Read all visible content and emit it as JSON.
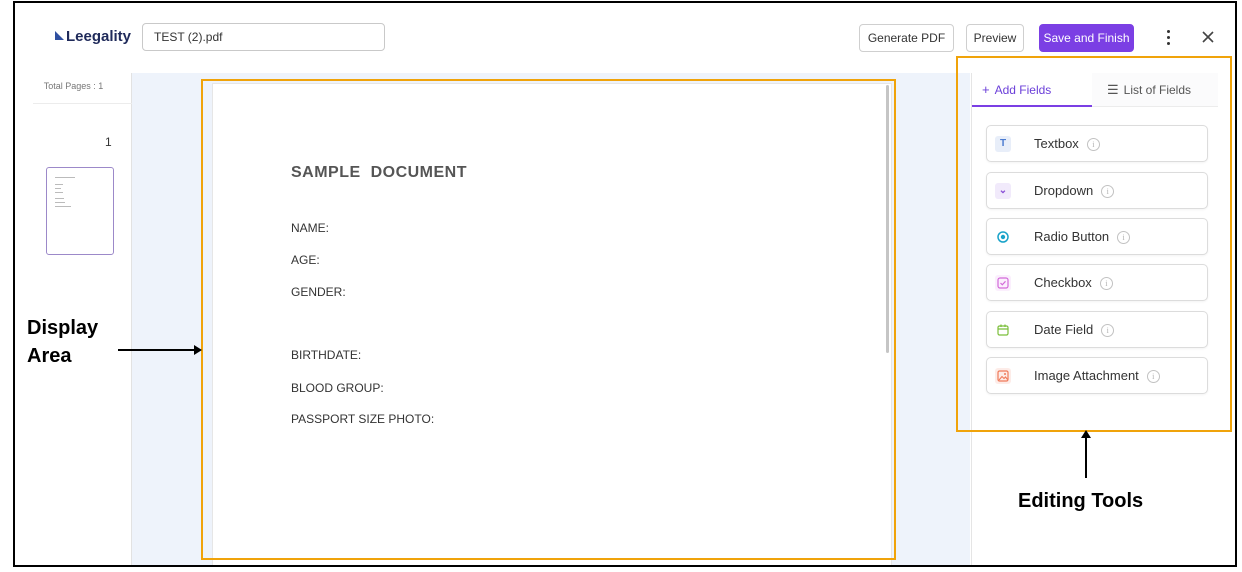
{
  "header": {
    "logo": "Leegality",
    "file_name": "TEST (2).pdf",
    "generate_pdf": "Generate PDF",
    "preview": "Preview",
    "save_and_finish": "Save and Finish",
    "more_icon": "kebab-vertical-icon",
    "close_icon": "close-icon"
  },
  "sidebar": {
    "total_pages": "Total Pages : 1",
    "page_number": "1"
  },
  "document": {
    "title": "SAMPLE  DOCUMENT",
    "lines": [
      "NAME:",
      "AGE:",
      "GENDER:",
      "BIRTHDATE:",
      "BLOOD GROUP:",
      "PASSPORT SIZE PHOTO:"
    ]
  },
  "tools": {
    "tabs": [
      {
        "label": "Add Fields",
        "icon": "plus-icon",
        "active": true
      },
      {
        "label": "List of Fields",
        "icon": "list-icon",
        "active": false
      }
    ],
    "fields": [
      {
        "label": "Textbox",
        "icon": "text-icon",
        "color": "#4a7bd0",
        "bg": "#e8eef9"
      },
      {
        "label": "Dropdown",
        "icon": "chevron-down-icon",
        "color": "#8a4fd6",
        "bg": "#f1eafb"
      },
      {
        "label": "Radio Button",
        "icon": "radio-icon",
        "color": "#1aa3c9",
        "bg": "#ffffff"
      },
      {
        "label": "Checkbox",
        "icon": "checkbox-icon",
        "color": "#d36ad9",
        "bg": "#fbeffd"
      },
      {
        "label": "Date Field",
        "icon": "calendar-icon",
        "color": "#7bbf3a",
        "bg": "#ffffff"
      },
      {
        "label": "Image Attachment",
        "icon": "image-icon",
        "color": "#f07a5a",
        "bg": "#fdece8"
      }
    ]
  },
  "annotations": {
    "display_area": "Display\nArea",
    "display_area_line1": "Display",
    "display_area_line2": "Area",
    "editing_tools": "Editing Tools",
    "highlight_color": "#f0a30a"
  },
  "colors": {
    "accent": "#7b3fe4",
    "viewer_bg": "#eef3fb"
  }
}
